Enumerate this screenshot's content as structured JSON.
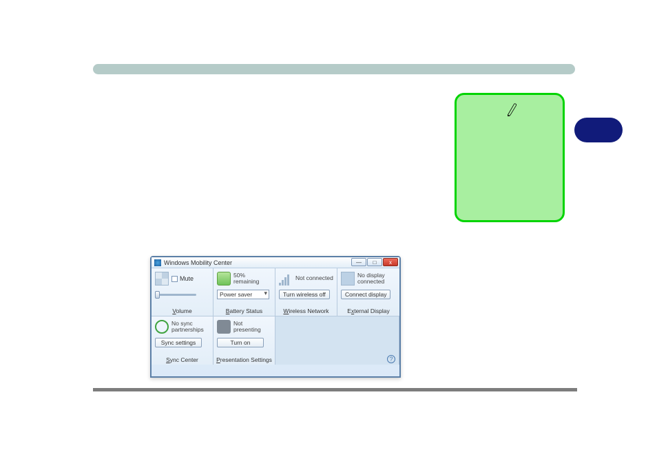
{
  "colors": {
    "heading_bar": "#b5cbc8",
    "note_bg": "#a8efa0",
    "note_border": "#00d400",
    "pill": "#111b7a"
  },
  "blue_pill": {
    "label": ""
  },
  "wmc": {
    "title": "Windows Mobility Center",
    "window_buttons": {
      "minimize": "—",
      "maximize": "□",
      "close": "x"
    },
    "help_label": "?",
    "tiles": {
      "volume": {
        "mute_label": "Mute",
        "footer_html": "Volume",
        "footer_u": "V"
      },
      "battery": {
        "status": "50% remaining",
        "plan": "Power saver",
        "footer": "Battery Status",
        "footer_u": "B"
      },
      "wireless": {
        "status": "Not connected",
        "button": "Turn wireless off",
        "footer": "Wireless Network",
        "footer_u": "W"
      },
      "display": {
        "status": "No display connected",
        "button": "Connect display",
        "footer": "External Display",
        "footer_u": "x"
      },
      "sync": {
        "status": "No sync partnerships",
        "button": "Sync settings",
        "footer": "Sync Center",
        "footer_u": "S"
      },
      "presentation": {
        "status": "Not presenting",
        "button": "Turn on",
        "footer": "Presentation Settings",
        "footer_u": "P"
      }
    }
  }
}
